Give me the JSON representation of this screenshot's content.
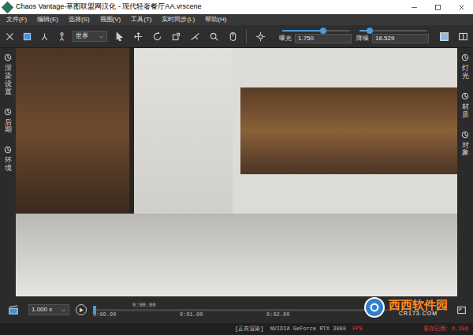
{
  "window": {
    "title": "Chaos Vantage-草图联盟网汉化 - 现代轻奢餐厅AA.vrscene"
  },
  "menu": [
    "文件(F)",
    "编辑(E)",
    "选择(S)",
    "视图(V)",
    "工具(T)",
    "实时同步(L)",
    "帮助(H)"
  ],
  "toolbar": {
    "coordinate_space": "世界",
    "exposure": {
      "label": "曝光",
      "value": "1.750",
      "level": 0.6
    },
    "denoise": {
      "label": "降噪",
      "value": "16.529",
      "level": 0.15
    }
  },
  "left_panel": [
    {
      "label": "渲染设置"
    },
    {
      "label": "后期"
    },
    {
      "label": "环境"
    }
  ],
  "right_panel": [
    {
      "label": "灯光"
    },
    {
      "label": "材质"
    },
    {
      "label": "对象"
    }
  ],
  "timeline": {
    "speed": "1.000 x",
    "play": "▶",
    "current_time": "0:00.00",
    "ticks": [
      "0:00.00",
      "0:01.00",
      "0:02.00"
    ],
    "level": 0
  },
  "status": {
    "state": "[正在渲染]",
    "gpu": "NVIDIA GeForce RTX 3080",
    "fps": "FPS",
    "memory": "显存已用: 6.156"
  },
  "watermark": {
    "name": "西西软件园",
    "url": "CR173.COM"
  }
}
